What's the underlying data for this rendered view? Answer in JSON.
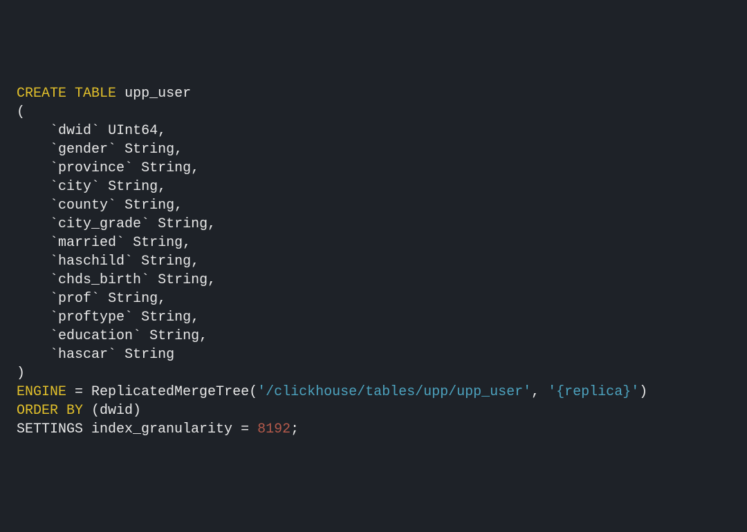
{
  "sql": {
    "create": "CREATE",
    "table": "TABLE",
    "table_name": "upp_user",
    "open_paren": "(",
    "columns": [
      {
        "name": "dwid",
        "type": "UInt64",
        "comma": ","
      },
      {
        "name": "gender",
        "type": "String",
        "comma": ","
      },
      {
        "name": "province",
        "type": "String",
        "comma": ","
      },
      {
        "name": "city",
        "type": "String",
        "comma": ","
      },
      {
        "name": "county",
        "type": "String",
        "comma": ","
      },
      {
        "name": "city_grade",
        "type": "String",
        "comma": ","
      },
      {
        "name": "married",
        "type": "String",
        "comma": ","
      },
      {
        "name": "haschild",
        "type": "String",
        "comma": ","
      },
      {
        "name": "chds_birth",
        "type": "String",
        "comma": ","
      },
      {
        "name": "prof",
        "type": "String",
        "comma": ","
      },
      {
        "name": "proftype",
        "type": "String",
        "comma": ","
      },
      {
        "name": "education",
        "type": "String",
        "comma": ","
      },
      {
        "name": "hascar",
        "type": "String",
        "comma": ""
      }
    ],
    "close_paren": ")",
    "engine_kw": "ENGINE",
    "eq": " = ",
    "engine_fn": "ReplicatedMergeTree(",
    "engine_str1": "'/clickhouse/tables/upp/upp_user'",
    "engine_comma": ", ",
    "engine_str2": "'{replica}'",
    "engine_close": ")",
    "order_kw": "ORDER",
    "by_kw": "BY",
    "order_expr": " (dwid)",
    "settings_kw": "SETTINGS",
    "settings_name": " index_granularity ",
    "settings_eq": "= ",
    "settings_val": "8192",
    "semi": ";"
  }
}
